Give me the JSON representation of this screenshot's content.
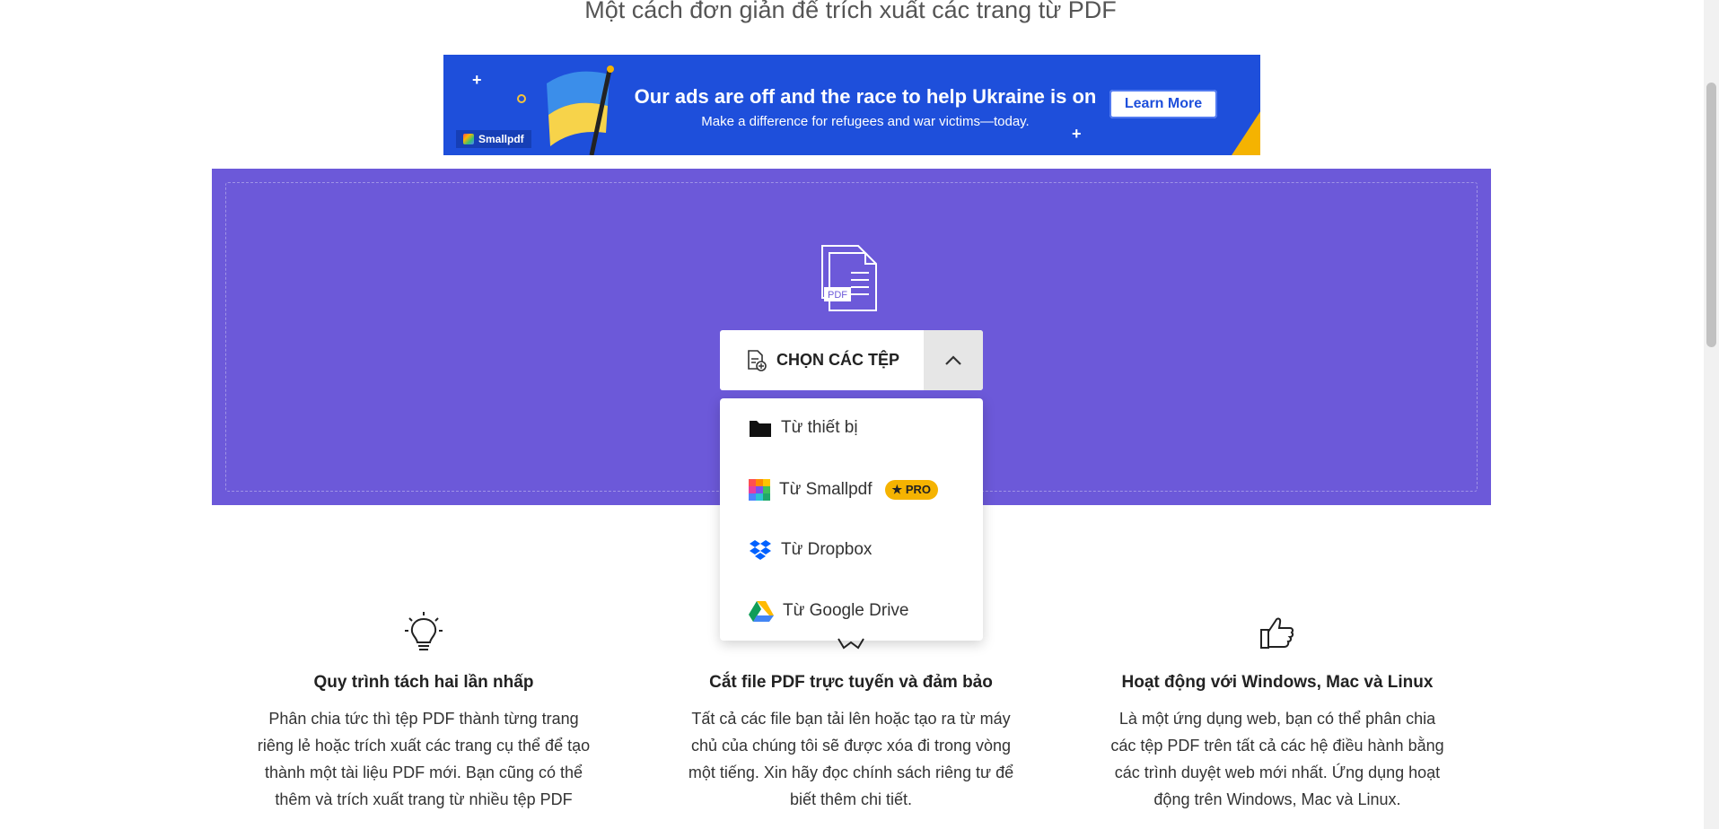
{
  "page": {
    "subtitle": "Một cách đơn giản để trích xuất các trang từ PDF"
  },
  "banner": {
    "headline": "Our ads are off and the race to help Ukraine is on",
    "sub": "Make a difference for refugees and war victims—today.",
    "cta": "Learn More",
    "brand": "Smallpdf"
  },
  "upload": {
    "choose_label": "CHỌN CÁC TỆP",
    "menu": [
      {
        "label": "Từ thiết bị",
        "icon": "folder-icon"
      },
      {
        "label": "Từ Smallpdf",
        "icon": "smallpdf-icon",
        "badge": "PRO"
      },
      {
        "label": "Từ Dropbox",
        "icon": "dropbox-icon"
      },
      {
        "label": "Từ Google Drive",
        "icon": "google-drive-icon"
      }
    ]
  },
  "features": [
    {
      "icon": "lightbulb-icon",
      "title": "Quy trình tách hai lần nhấp",
      "text": "Phân chia tức thì tệp PDF thành từng trang riêng lẻ hoặc trích xuất các trang cụ thể để tạo thành một tài liệu PDF mới. Bạn cũng có thể thêm và trích xuất trang từ nhiều tệp PDF"
    },
    {
      "icon": "shield-icon",
      "title": "Cắt file PDF trực tuyến và đảm bảo",
      "text": "Tất cả các file bạn tải lên hoặc tạo ra từ máy chủ của chúng tôi sẽ được xóa đi trong vòng một tiếng. Xin hãy đọc chính sách riêng tư để biết thêm chi tiết."
    },
    {
      "icon": "thumbs-up-icon",
      "title": "Hoạt động với Windows, Mac và Linux",
      "text": "Là một ứng dụng web, bạn có thể phân chia các tệp PDF trên tất cả các hệ điều hành bằng các trình duyệt web mới nhất. Ứng dụng hoạt động trên Windows, Mac và Linux."
    }
  ],
  "colors": {
    "dropzone": "#6c59d9",
    "banner": "#1e4fdb",
    "pro_badge": "#f5b301"
  }
}
